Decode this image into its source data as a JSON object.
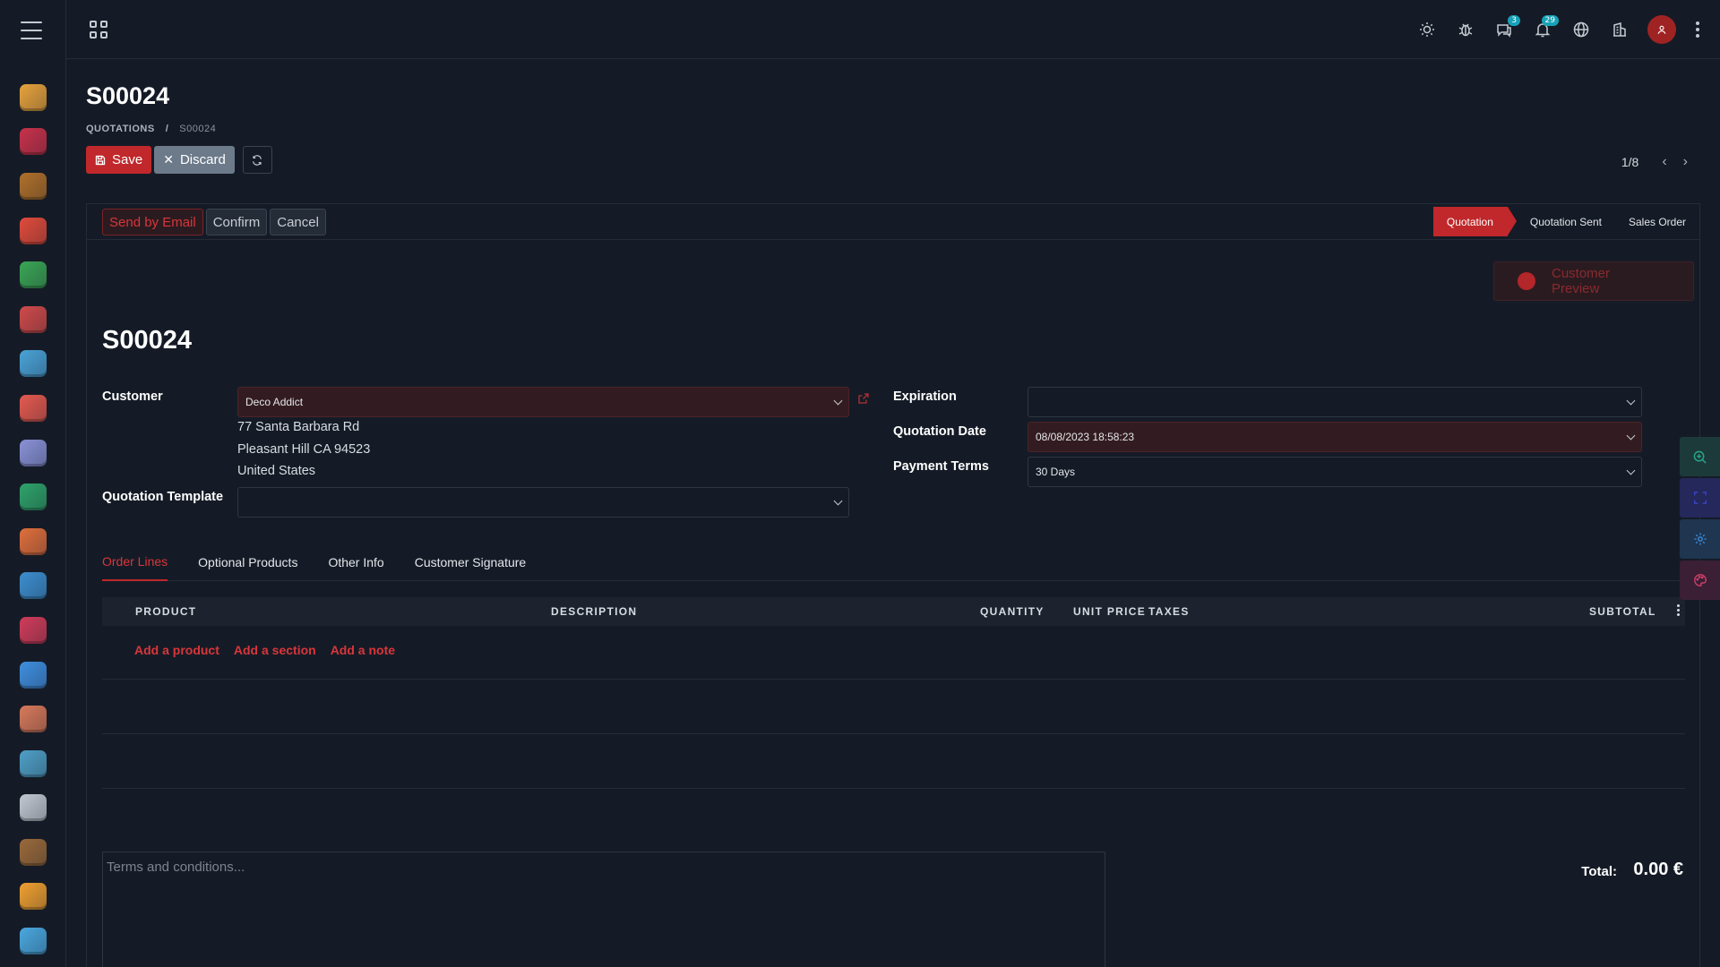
{
  "topbar": {
    "badges": {
      "messages": "3",
      "activities": "29"
    }
  },
  "sidebar": {
    "apps": [
      {
        "name": "discuss-app-icon",
        "color": "#e8a33c"
      },
      {
        "name": "calendar-app-icon",
        "color": "#c9314b"
      },
      {
        "name": "contacts-app-icon",
        "color": "#b0702a"
      },
      {
        "name": "crm-app-icon",
        "color": "#e14b3b"
      },
      {
        "name": "sales-app-icon",
        "color": "#3aa655"
      },
      {
        "name": "dashboards-app-icon",
        "color": "#d04a4a"
      },
      {
        "name": "accounting-app-icon",
        "color": "#4aa3d8"
      },
      {
        "name": "project-app-icon",
        "color": "#e55a4f"
      },
      {
        "name": "timesheets-app-icon",
        "color": "#8a92d8"
      },
      {
        "name": "expenses-app-icon",
        "color": "#2ea36a"
      },
      {
        "name": "purchase-app-icon",
        "color": "#e06f3c"
      },
      {
        "name": "manufacturing-app-icon",
        "color": "#3c8fd0"
      },
      {
        "name": "inventory-app-icon",
        "color": "#d13c5a"
      },
      {
        "name": "maintenance-app-icon",
        "color": "#3f8fe0"
      },
      {
        "name": "employees-app-icon",
        "color": "#d8795a"
      },
      {
        "name": "fleet-app-icon",
        "color": "#4fa0c8"
      },
      {
        "name": "attendance-app-icon",
        "color": "#c2c9d2"
      },
      {
        "name": "payroll-app-icon",
        "color": "#9a6a3a"
      },
      {
        "name": "appraisals-app-icon",
        "color": "#f0a030"
      },
      {
        "name": "live-chat-app-icon",
        "color": "#4aa8e0"
      }
    ]
  },
  "header": {
    "title": "S00024",
    "breadcrumb": {
      "parent": "QUOTATIONS",
      "separator": "/",
      "current": "S00024"
    },
    "save_label": "Save",
    "discard_label": "Discard",
    "pager": "1/8"
  },
  "statusbar": {
    "buttons": {
      "send": "Send by Email",
      "confirm": "Confirm",
      "cancel": "Cancel"
    },
    "stages": {
      "quotation": "Quotation",
      "sent": "Quotation Sent",
      "order": "Sales Order"
    }
  },
  "form": {
    "preview": {
      "line1": "Customer",
      "line2": "Preview"
    },
    "name": "S00024",
    "customer": {
      "label": "Customer",
      "value": "Deco Addict",
      "address": [
        "77 Santa Barbara Rd",
        "Pleasant Hill CA 94523",
        "United States"
      ]
    },
    "template": {
      "label": "Quotation Template",
      "value": ""
    },
    "expiration": {
      "label": "Expiration",
      "value": ""
    },
    "quotation_date": {
      "label": "Quotation Date",
      "value": "08/08/2023 18:58:23"
    },
    "payment_terms": {
      "label": "Payment Terms",
      "value": "30 Days"
    }
  },
  "tabs": [
    "Order Lines",
    "Optional Products",
    "Other Info",
    "Customer Signature"
  ],
  "order_lines": {
    "columns": {
      "product": "PRODUCT",
      "description": "DESCRIPTION",
      "quantity": "QUANTITY",
      "unit_price": "UNIT PRICE",
      "taxes": "TAXES",
      "subtotal": "SUBTOTAL"
    },
    "add_links": {
      "product": "Add a product",
      "section": "Add a section",
      "note": "Add a note"
    }
  },
  "terms_placeholder": "Terms and conditions...",
  "totals": {
    "label": "Total:",
    "value": "0.00 €"
  },
  "accent_color": "#c0282b"
}
